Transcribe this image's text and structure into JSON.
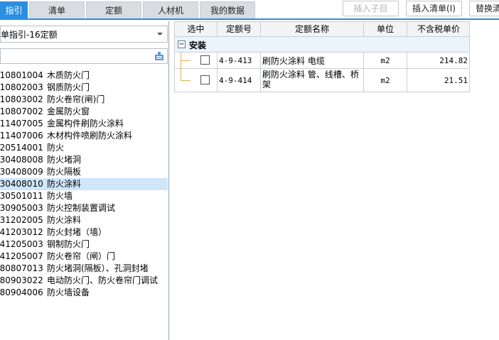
{
  "tabs": [
    {
      "label": "指引",
      "active": true
    },
    {
      "label": "清单",
      "active": false
    },
    {
      "label": "定额",
      "active": false
    },
    {
      "label": "人材机",
      "active": false
    },
    {
      "label": "我的数据",
      "active": false
    }
  ],
  "toolbar": {
    "insert_child_label": "插入子目",
    "insert_list_label": "插入清单(I)",
    "replace_list_label": "替换清"
  },
  "left_panel": {
    "guide_select_value": "单指引-16定额",
    "search_placeholder": "",
    "items": [
      {
        "code": "010801004",
        "name": "木质防火门",
        "selected": false
      },
      {
        "code": "010802003",
        "name": "钢质防火门",
        "selected": false
      },
      {
        "code": "010803002",
        "name": "防火卷帘(闸)门",
        "selected": false
      },
      {
        "code": "010807002",
        "name": "金属防火窗",
        "selected": false
      },
      {
        "code": "011407005",
        "name": "金属构件刷防火涂料",
        "selected": false
      },
      {
        "code": "011407006",
        "name": "木材构件喷刷防火涂料",
        "selected": false
      },
      {
        "code": "020514001",
        "name": "防火",
        "selected": false
      },
      {
        "code": "030408008",
        "name": "防火堵洞",
        "selected": false
      },
      {
        "code": "030408009",
        "name": "防火隔板",
        "selected": false
      },
      {
        "code": "030408010",
        "name": "防火涂料",
        "selected": true
      },
      {
        "code": "030501011",
        "name": "防火墙",
        "selected": false
      },
      {
        "code": "030905003",
        "name": "防火控制装置调试",
        "selected": false
      },
      {
        "code": "031202005",
        "name": "防火涂料",
        "selected": false
      },
      {
        "code": "041203012",
        "name": "防火封堵（墙）",
        "selected": false
      },
      {
        "code": "041205003",
        "name": "钢制防火门",
        "selected": false
      },
      {
        "code": "041205007",
        "name": "防火卷帘（闸）门",
        "selected": false
      },
      {
        "code": "080807013",
        "name": "防火堵洞(隔板）、孔洞封堵",
        "selected": false
      },
      {
        "code": "080903022",
        "name": "电动防火门、防火卷帘门调试",
        "selected": false
      },
      {
        "code": "080904006",
        "name": "防火墙设备",
        "selected": false
      }
    ]
  },
  "grid": {
    "columns": [
      "选中",
      "定额号",
      "定额名称",
      "单位",
      "不含税单价"
    ],
    "group": {
      "toggle": "−",
      "label": "安装"
    },
    "rows": [
      {
        "code": "4-9-413",
        "name": "刷防火涂料 电缆",
        "unit": "m2",
        "price": "214.82",
        "checked": false
      },
      {
        "code": "4-9-414",
        "name": "刷防火涂料 管、线槽、桥架",
        "unit": "m2",
        "price": "21.51",
        "checked": false
      }
    ]
  },
  "colors": {
    "accent": "#2b8ee0",
    "selected_row": "#cfe6fb",
    "tree_line": "#e0b050"
  }
}
